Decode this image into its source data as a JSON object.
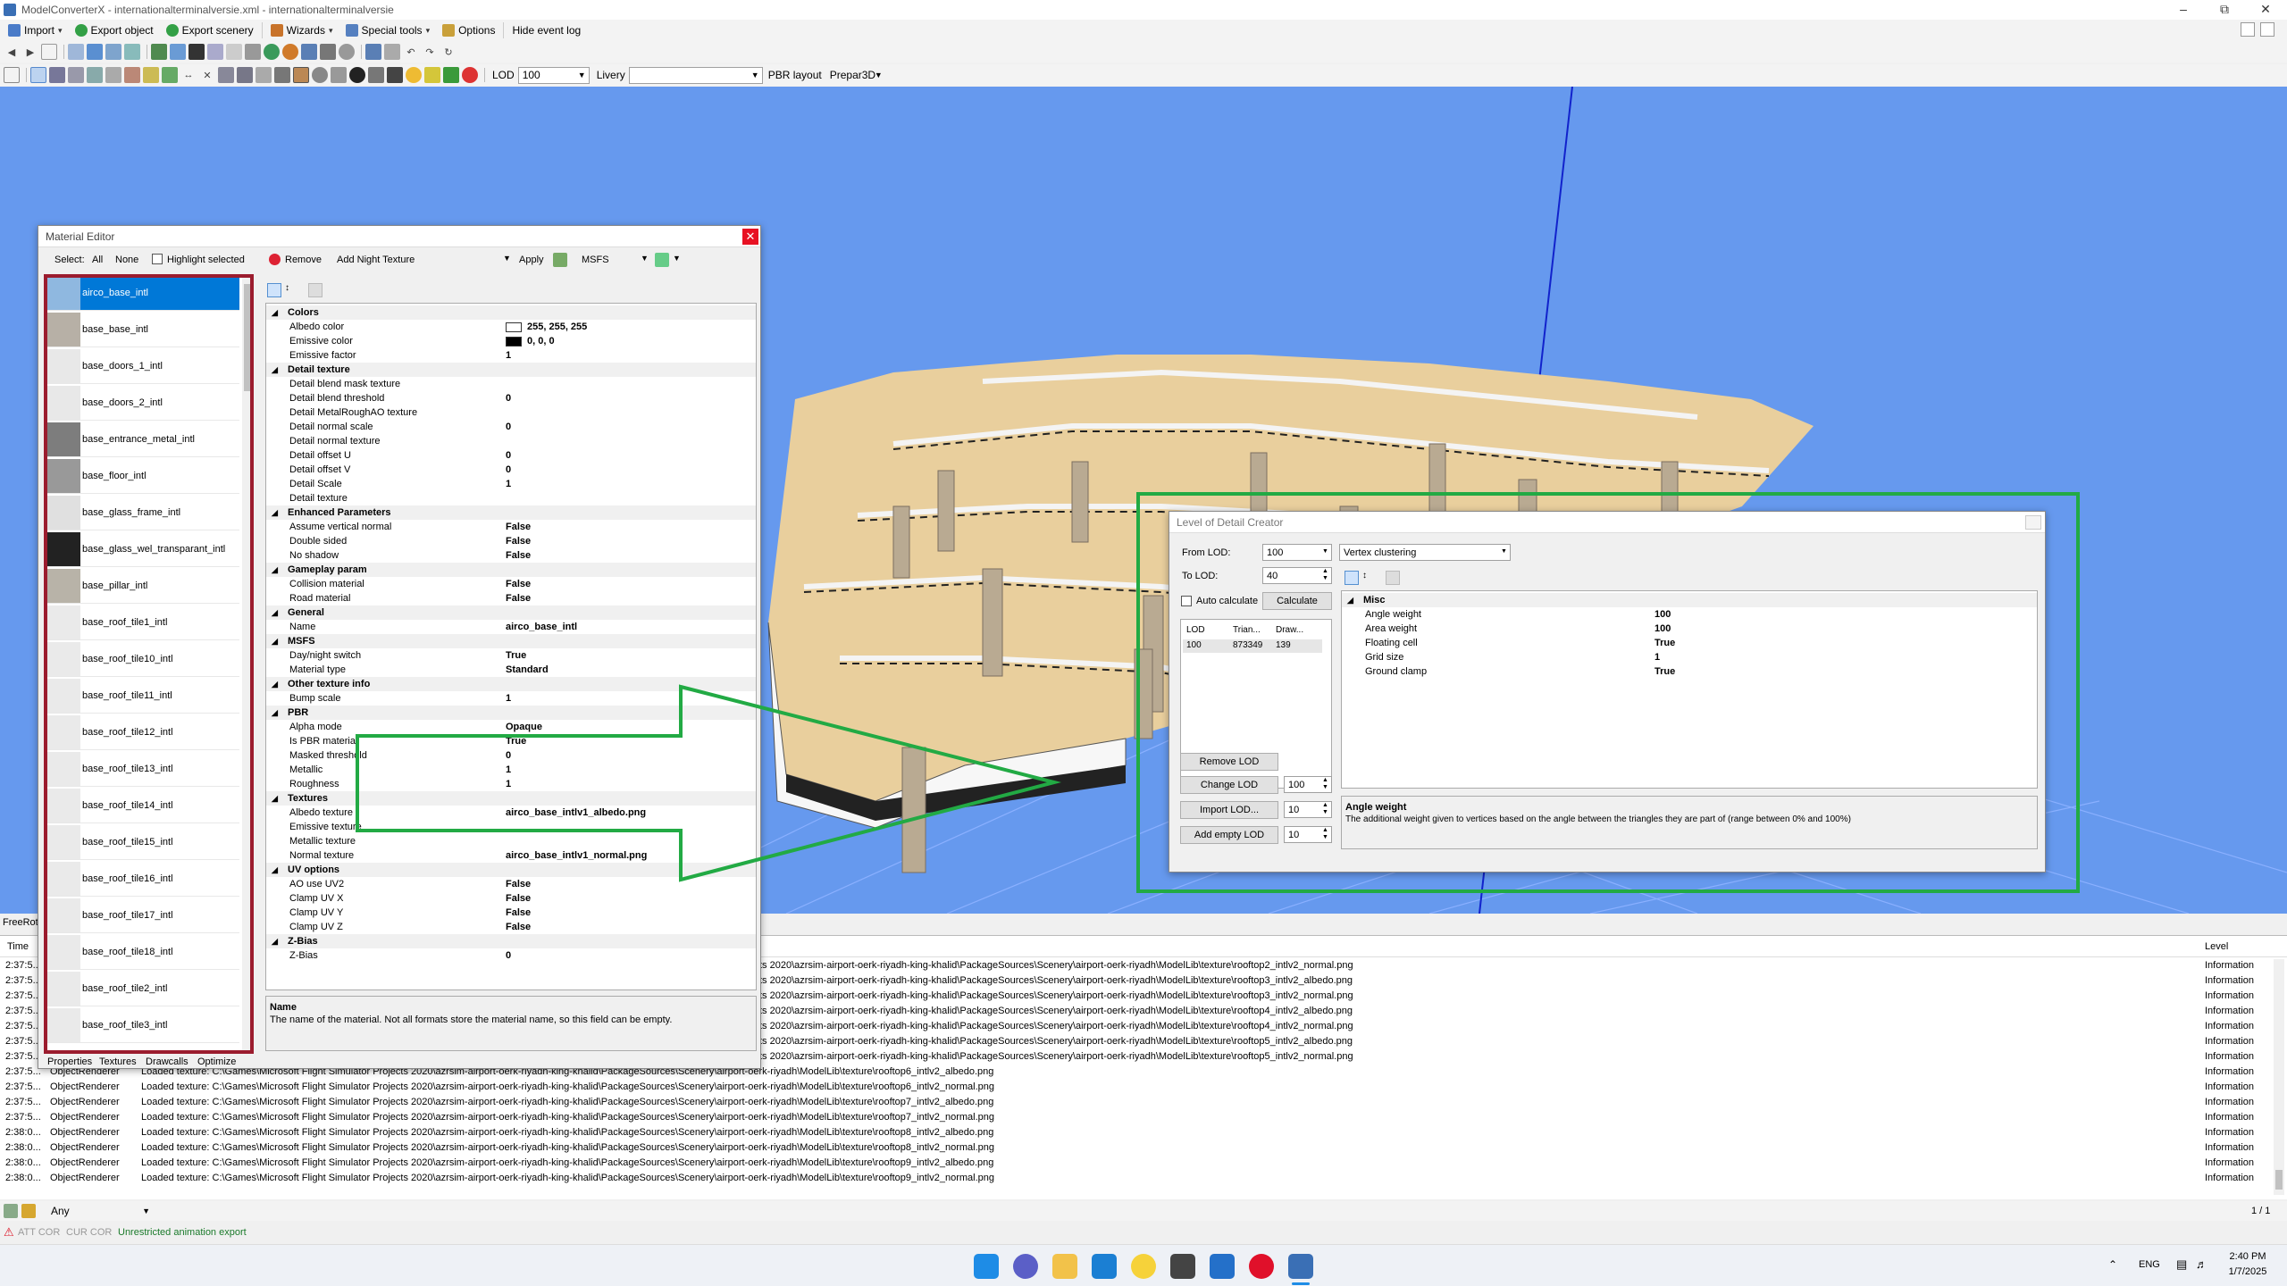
{
  "titlebar": {
    "title": "ModelConverterX - internationalterminalversie.xml - internationalterminalversie"
  },
  "menu": {
    "import": "Import",
    "export_object": "Export object",
    "export_scenery": "Export scenery",
    "wizards": "Wizards",
    "special_tools": "Special tools",
    "options": "Options",
    "hide_event_log": "Hide event log"
  },
  "toolbar3": {
    "lod_label": "LOD",
    "lod_value": "100",
    "livery_label": "Livery",
    "livery_value": "",
    "pbr_label": "PBR layout",
    "pbr_value": "Prepar3D"
  },
  "material_editor": {
    "title": "Material Editor",
    "select_label": "Select:",
    "all": "All",
    "none": "None",
    "highlight_selected": "Highlight selected",
    "remove": "Remove",
    "add_night_texture": "Add Night Texture",
    "apply": "Apply",
    "format": "MSFS",
    "textures": [
      "airco_base_intl",
      "base_base_intl",
      "base_doors_1_intl",
      "base_doors_2_intl",
      "base_entrance_metal_intl",
      "base_floor_intl",
      "base_glass_frame_intl",
      "base_glass_wel_transparant_intl",
      "base_pillar_intl",
      "base_roof_tile1_intl",
      "base_roof_tile10_intl",
      "base_roof_tile11_intl",
      "base_roof_tile12_intl",
      "base_roof_tile13_intl",
      "base_roof_tile14_intl",
      "base_roof_tile15_intl",
      "base_roof_tile16_intl",
      "base_roof_tile17_intl",
      "base_roof_tile18_intl",
      "base_roof_tile2_intl",
      "base_roof_tile3_intl"
    ],
    "properties": [
      {
        "cat": "Colors"
      },
      {
        "k": "Albedo color",
        "v": "255, 255, 255",
        "swatch": "#ffffff"
      },
      {
        "k": "Emissive color",
        "v": "0, 0, 0",
        "swatch": "#000000"
      },
      {
        "k": "Emissive factor",
        "v": "1"
      },
      {
        "cat": "Detail texture"
      },
      {
        "k": "Detail blend mask texture",
        "v": ""
      },
      {
        "k": "Detail blend threshold",
        "v": "0"
      },
      {
        "k": "Detail MetalRoughAO texture",
        "v": ""
      },
      {
        "k": "Detail normal scale",
        "v": "0"
      },
      {
        "k": "Detail normal texture",
        "v": ""
      },
      {
        "k": "Detail offset U",
        "v": "0"
      },
      {
        "k": "Detail offset V",
        "v": "0"
      },
      {
        "k": "Detail Scale",
        "v": "1"
      },
      {
        "k": "Detail texture",
        "v": ""
      },
      {
        "cat": "Enhanced Parameters"
      },
      {
        "k": "Assume vertical normal",
        "v": "False"
      },
      {
        "k": "Double sided",
        "v": "False"
      },
      {
        "k": "No shadow",
        "v": "False"
      },
      {
        "cat": "Gameplay param"
      },
      {
        "k": "Collision material",
        "v": "False"
      },
      {
        "k": "Road material",
        "v": "False"
      },
      {
        "cat": "General"
      },
      {
        "k": "Name",
        "v": "airco_base_intl"
      },
      {
        "cat": "MSFS"
      },
      {
        "k": "Day/night switch",
        "v": "True"
      },
      {
        "k": "Material type",
        "v": "Standard"
      },
      {
        "cat": "Other texture info"
      },
      {
        "k": "Bump scale",
        "v": "1"
      },
      {
        "cat": "PBR"
      },
      {
        "k": "Alpha mode",
        "v": "Opaque"
      },
      {
        "k": "Is PBR material",
        "v": "True"
      },
      {
        "k": "Masked threshold",
        "v": "0"
      },
      {
        "k": "Metallic",
        "v": "1"
      },
      {
        "k": "Roughness",
        "v": "1"
      },
      {
        "cat": "Textures"
      },
      {
        "k": "Albedo texture",
        "v": "airco_base_intlv1_albedo.png"
      },
      {
        "k": "Emissive texture",
        "v": ""
      },
      {
        "k": "Metallic texture",
        "v": ""
      },
      {
        "k": "Normal texture",
        "v": "airco_base_intlv1_normal.png"
      },
      {
        "cat": "UV options"
      },
      {
        "k": "AO use UV2",
        "v": "False"
      },
      {
        "k": "Clamp UV X",
        "v": "False"
      },
      {
        "k": "Clamp UV Y",
        "v": "False"
      },
      {
        "k": "Clamp UV Z",
        "v": "False"
      },
      {
        "cat": "Z-Bias"
      },
      {
        "k": "Z-Bias",
        "v": "0"
      }
    ],
    "desc_title": "Name",
    "desc_text": "The name of the material. Not all formats store the material name, so this field can be empty.",
    "tabs": [
      "Properties",
      "Textures",
      "Drawcalls",
      "Optimize"
    ]
  },
  "lod_creator": {
    "title": "Level of Detail Creator",
    "from_lod_label": "From LOD:",
    "from_lod_value": "100",
    "method": "Vertex clustering",
    "to_lod_label": "To LOD:",
    "to_lod_value": "40",
    "auto_calculate": "Auto calculate",
    "calculate": "Calculate",
    "table_headers": [
      "LOD",
      "Trian...",
      "Draw..."
    ],
    "table_rows": [
      [
        "100",
        "873349",
        "139"
      ]
    ],
    "remove_lod": "Remove LOD",
    "change_lod": "Change LOD",
    "change_lod_value": "100",
    "import_lod": "Import LOD...",
    "import_lod_value": "10",
    "add_empty_lod": "Add empty LOD",
    "add_empty_lod_value": "10",
    "misc_cat": "Misc",
    "props": [
      {
        "k": "Angle weight",
        "v": "100"
      },
      {
        "k": "Area weight",
        "v": "100"
      },
      {
        "k": "Floating cell",
        "v": "True"
      },
      {
        "k": "Grid size",
        "v": "1"
      },
      {
        "k": "Ground clamp",
        "v": "True"
      }
    ],
    "desc_title": "Angle weight",
    "desc_text": "The additional weight given to vertices based on the angle between the triangles they are part of (range between 0% and 100%)"
  },
  "viewport": {
    "mode_label": "FreeRot"
  },
  "log": {
    "headers": {
      "time": "Time",
      "level": "Level"
    },
    "rows": [
      {
        "time": "2:37:5...",
        "src": "",
        "msg": "ts 2020\\azrsim-airport-oerk-riyadh-king-khalid\\PackageSources\\Scenery\\airport-oerk-riyadh\\ModelLib\\texture\\rooftop2_intlv2_normal.png",
        "level": "Information"
      },
      {
        "time": "2:37:5...",
        "src": "",
        "msg": "ts 2020\\azrsim-airport-oerk-riyadh-king-khalid\\PackageSources\\Scenery\\airport-oerk-riyadh\\ModelLib\\texture\\rooftop3_intlv2_albedo.png",
        "level": "Information"
      },
      {
        "time": "2:37:5...",
        "src": "",
        "msg": "ts 2020\\azrsim-airport-oerk-riyadh-king-khalid\\PackageSources\\Scenery\\airport-oerk-riyadh\\ModelLib\\texture\\rooftop3_intlv2_normal.png",
        "level": "Information"
      },
      {
        "time": "2:37:5...",
        "src": "",
        "msg": "ts 2020\\azrsim-airport-oerk-riyadh-king-khalid\\PackageSources\\Scenery\\airport-oerk-riyadh\\ModelLib\\texture\\rooftop4_intlv2_albedo.png",
        "level": "Information"
      },
      {
        "time": "2:37:5...",
        "src": "",
        "msg": "ts 2020\\azrsim-airport-oerk-riyadh-king-khalid\\PackageSources\\Scenery\\airport-oerk-riyadh\\ModelLib\\texture\\rooftop4_intlv2_normal.png",
        "level": "Information"
      },
      {
        "time": "2:37:5...",
        "src": "",
        "msg": "ts 2020\\azrsim-airport-oerk-riyadh-king-khalid\\PackageSources\\Scenery\\airport-oerk-riyadh\\ModelLib\\texture\\rooftop5_intlv2_albedo.png",
        "level": "Information"
      },
      {
        "time": "2:37:5...",
        "src": "",
        "msg": "ts 2020\\azrsim-airport-oerk-riyadh-king-khalid\\PackageSources\\Scenery\\airport-oerk-riyadh\\ModelLib\\texture\\rooftop5_intlv2_normal.png",
        "level": "Information"
      },
      {
        "time": "2:37:5...",
        "src": "ObjectRenderer",
        "msg": "Loaded texture: C:\\Games\\Microsoft Flight Simulator Projects 2020\\azrsim-airport-oerk-riyadh-king-khalid\\PackageSources\\Scenery\\airport-oerk-riyadh\\ModelLib\\texture\\rooftop6_intlv2_albedo.png",
        "level": "Information"
      },
      {
        "time": "2:37:5...",
        "src": "ObjectRenderer",
        "msg": "Loaded texture: C:\\Games\\Microsoft Flight Simulator Projects 2020\\azrsim-airport-oerk-riyadh-king-khalid\\PackageSources\\Scenery\\airport-oerk-riyadh\\ModelLib\\texture\\rooftop6_intlv2_normal.png",
        "level": "Information"
      },
      {
        "time": "2:37:5...",
        "src": "ObjectRenderer",
        "msg": "Loaded texture: C:\\Games\\Microsoft Flight Simulator Projects 2020\\azrsim-airport-oerk-riyadh-king-khalid\\PackageSources\\Scenery\\airport-oerk-riyadh\\ModelLib\\texture\\rooftop7_intlv2_albedo.png",
        "level": "Information"
      },
      {
        "time": "2:37:5...",
        "src": "ObjectRenderer",
        "msg": "Loaded texture: C:\\Games\\Microsoft Flight Simulator Projects 2020\\azrsim-airport-oerk-riyadh-king-khalid\\PackageSources\\Scenery\\airport-oerk-riyadh\\ModelLib\\texture\\rooftop7_intlv2_normal.png",
        "level": "Information"
      },
      {
        "time": "2:38:0...",
        "src": "ObjectRenderer",
        "msg": "Loaded texture: C:\\Games\\Microsoft Flight Simulator Projects 2020\\azrsim-airport-oerk-riyadh-king-khalid\\PackageSources\\Scenery\\airport-oerk-riyadh\\ModelLib\\texture\\rooftop8_intlv2_albedo.png",
        "level": "Information"
      },
      {
        "time": "2:38:0...",
        "src": "ObjectRenderer",
        "msg": "Loaded texture: C:\\Games\\Microsoft Flight Simulator Projects 2020\\azrsim-airport-oerk-riyadh-king-khalid\\PackageSources\\Scenery\\airport-oerk-riyadh\\ModelLib\\texture\\rooftop8_intlv2_normal.png",
        "level": "Information"
      },
      {
        "time": "2:38:0...",
        "src": "ObjectRenderer",
        "msg": "Loaded texture: C:\\Games\\Microsoft Flight Simulator Projects 2020\\azrsim-airport-oerk-riyadh-king-khalid\\PackageSources\\Scenery\\airport-oerk-riyadh\\ModelLib\\texture\\rooftop9_intlv2_albedo.png",
        "level": "Information"
      },
      {
        "time": "2:38:0...",
        "src": "ObjectRenderer",
        "msg": "Loaded texture: C:\\Games\\Microsoft Flight Simulator Projects 2020\\azrsim-airport-oerk-riyadh-king-khalid\\PackageSources\\Scenery\\airport-oerk-riyadh\\ModelLib\\texture\\rooftop9_intlv2_normal.png",
        "level": "Information"
      }
    ],
    "filter_value": "Any",
    "page": "1 / 1"
  },
  "status": {
    "att": "ATT COR",
    "cur": "CUR COR",
    "message": "Unrestricted animation export"
  },
  "taskbar": {
    "lang": "ENG",
    "time": "2:40 PM",
    "date": "1/7/2025"
  },
  "colors": {
    "viewport": "#6699ee",
    "highlight_red": "#9b1c2e",
    "highlight_green": "#22aa44",
    "selection": "#0078d7"
  }
}
